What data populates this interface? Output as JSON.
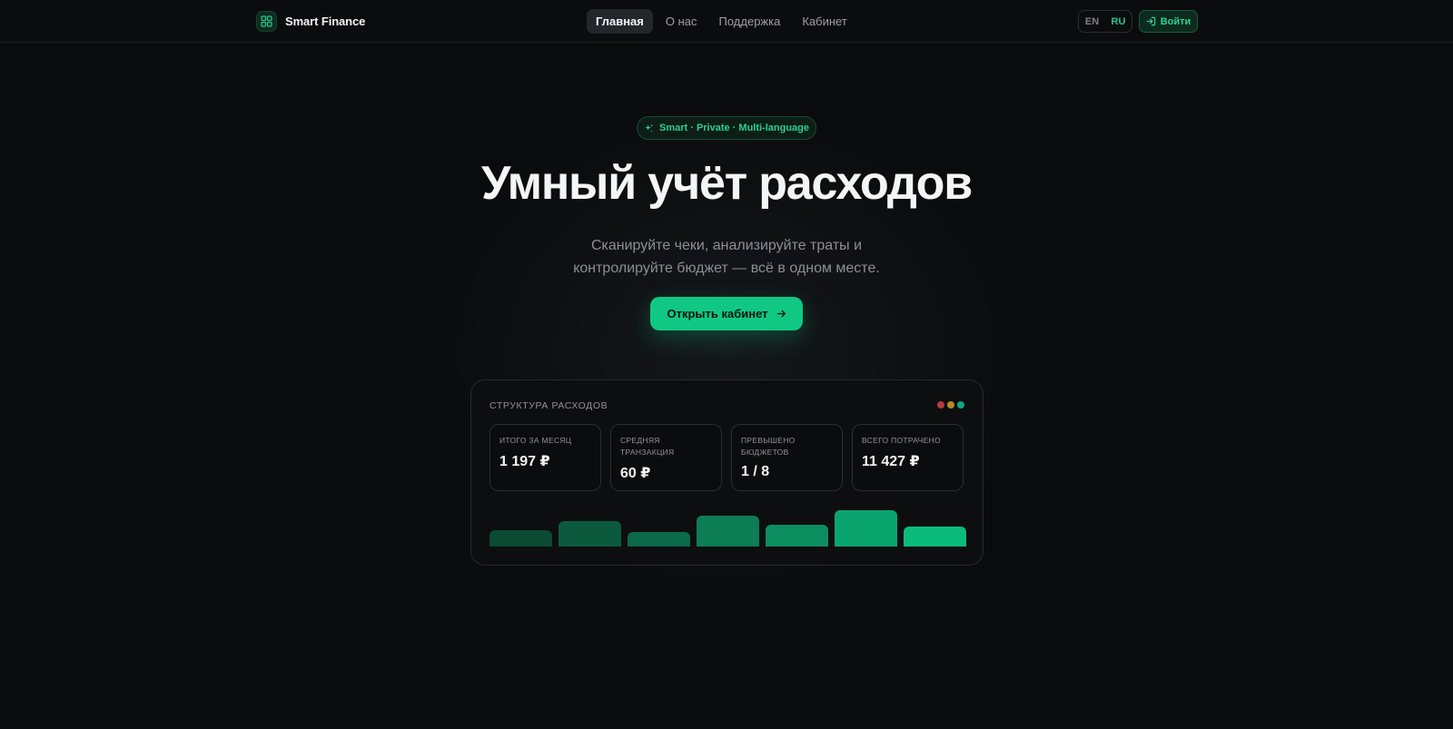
{
  "header": {
    "brand": "Smart Finance",
    "nav": [
      {
        "label": "Главная",
        "active": true
      },
      {
        "label": "О нас",
        "active": false
      },
      {
        "label": "Поддержка",
        "active": false
      },
      {
        "label": "Кабинет",
        "active": false
      }
    ],
    "lang": {
      "en": "EN",
      "ru": "RU",
      "selected": "RU"
    },
    "login_label": "Войти"
  },
  "hero": {
    "badge": "Smart · Private · Multi-language",
    "title": "Умный учёт расходов",
    "subtitle_line1": "Сканируйте чеки, анализируйте траты и",
    "subtitle_line2": "контролируйте бюджет — всё в одном месте.",
    "cta_label": "Открыть кабинет"
  },
  "card": {
    "title": "СТРУКТУРА РАСХОДОВ",
    "dot_colors": [
      "#b43c3c",
      "#b98a26",
      "#10a884"
    ],
    "stats": [
      {
        "label": "ИТОГО ЗА МЕСЯЦ",
        "value": "1 197 ₽"
      },
      {
        "label": "СРЕДНЯЯ ТРАНЗАКЦИЯ",
        "value": "60 ₽"
      },
      {
        "label": "ПРЕВЫШЕНО БЮДЖЕТОВ",
        "value": "1 / 8"
      },
      {
        "label": "ВСЕГО ПОТРАЧЕНО",
        "value": "11 427 ₽"
      }
    ],
    "bars": [
      {
        "level": 0.46,
        "color": "#0b4a33"
      },
      {
        "level": 0.69,
        "color": "#0c5a3e"
      },
      {
        "level": 0.41,
        "color": "#0b6a49"
      },
      {
        "level": 0.85,
        "color": "#0c7d55"
      },
      {
        "level": 0.59,
        "color": "#0c8e60"
      },
      {
        "level": 1.0,
        "color": "#0aa46e"
      },
      {
        "level": 0.56,
        "color": "#0bbb7c"
      }
    ]
  },
  "colors": {
    "accent": "#10c884",
    "background": "#0a0b0d"
  }
}
